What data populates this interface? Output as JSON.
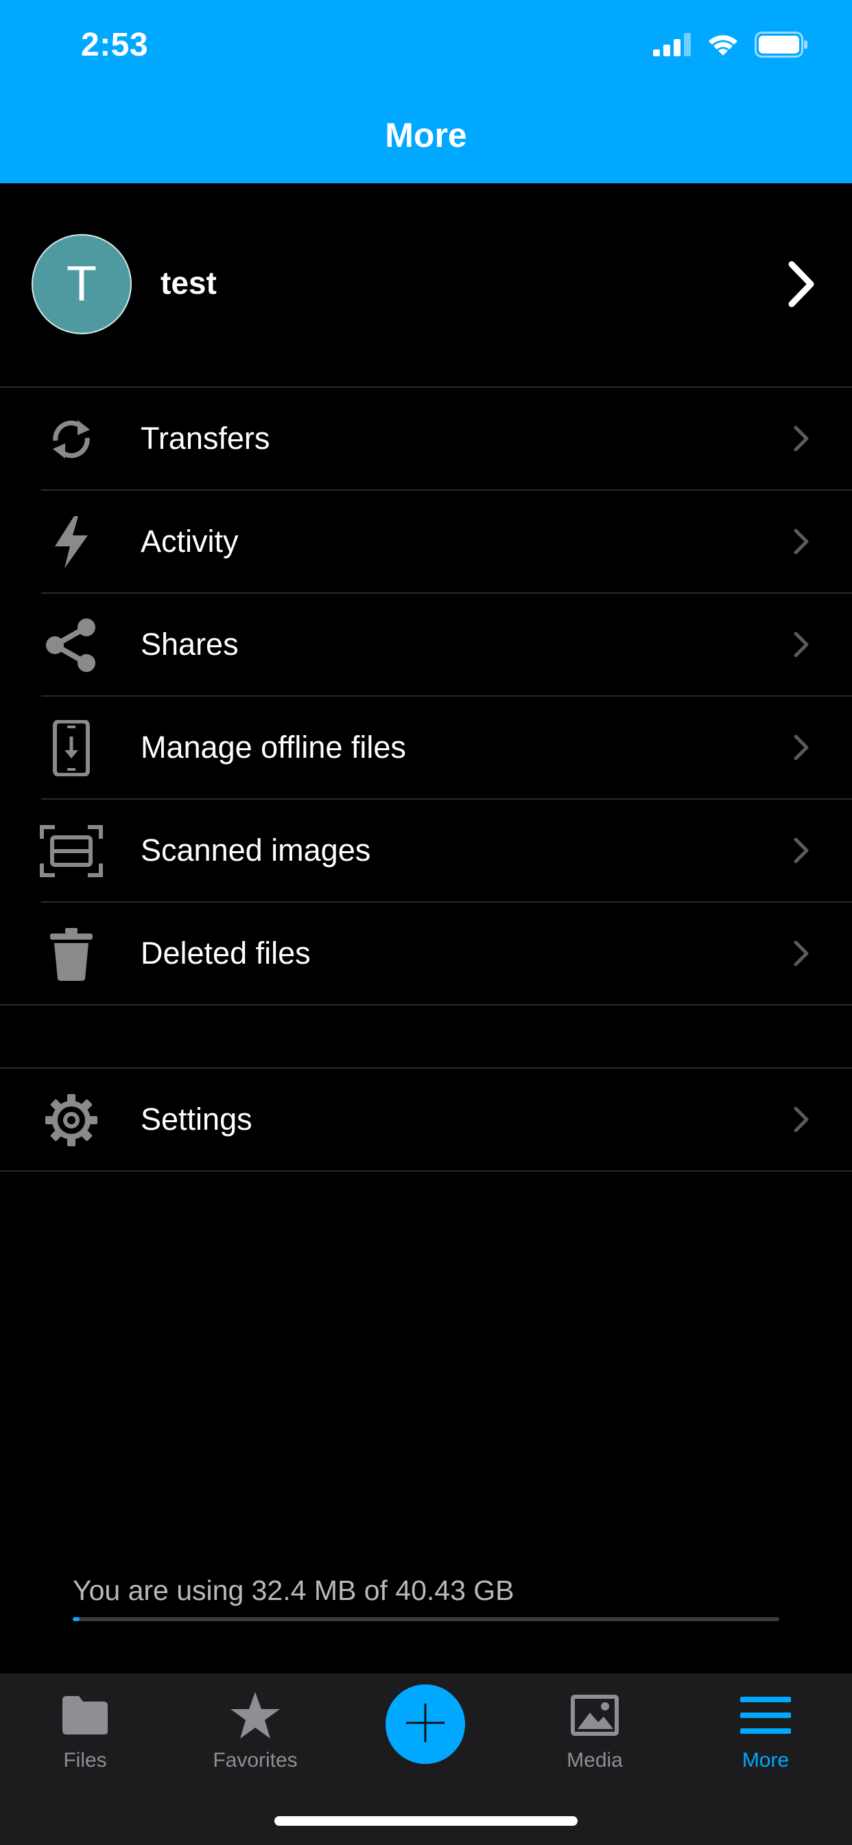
{
  "status_bar": {
    "time": "2:53"
  },
  "nav": {
    "title": "More"
  },
  "profile": {
    "initial": "T",
    "name": "test",
    "avatar_color": "#4f9aa0"
  },
  "menu": {
    "items": [
      {
        "label": "Transfers",
        "icon": "sync-icon"
      },
      {
        "label": "Activity",
        "icon": "lightning-icon"
      },
      {
        "label": "Shares",
        "icon": "share-icon"
      },
      {
        "label": "Manage offline files",
        "icon": "offline-device-icon"
      },
      {
        "label": "Scanned images",
        "icon": "scan-icon"
      },
      {
        "label": "Deleted files",
        "icon": "trash-icon"
      }
    ],
    "settings": {
      "label": "Settings",
      "icon": "gear-icon"
    }
  },
  "storage": {
    "text": "You are using 32.4 MB of 40.43 GB",
    "used_fraction": 0.001
  },
  "tabbar": {
    "tabs": [
      {
        "label": "Files",
        "icon": "folder-icon",
        "active": false
      },
      {
        "label": "Favorites",
        "icon": "star-icon",
        "active": false
      },
      {
        "label": "Media",
        "icon": "image-icon",
        "active": false
      },
      {
        "label": "More",
        "icon": "menu-icon",
        "active": true
      }
    ],
    "add_icon": "plus-icon"
  },
  "colors": {
    "accent": "#00a8ff",
    "background": "#000000",
    "tabbar": "#1c1c1e",
    "icon_gray": "#8a8a8a"
  }
}
